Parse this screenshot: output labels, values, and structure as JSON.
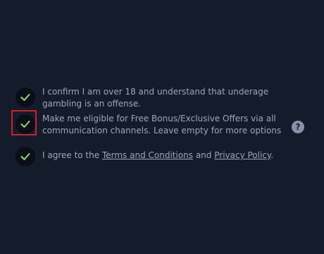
{
  "consents": {
    "age": {
      "text": "I confirm I am over 18 and understand that underage gambling is an offense.",
      "checked": true
    },
    "bonus": {
      "text": "Make me eligible for Free Bonus/Exclusive Offers via all communication channels. Leave empty for more options",
      "checked": true
    },
    "terms": {
      "prefix": "I agree to the ",
      "terms_link": "Terms and Conditions",
      "middle": " and ",
      "privacy_link": "Privacy Policy",
      "suffix": ".",
      "checked": true
    }
  },
  "help_icon": {
    "glyph": "?",
    "icon": "question-circle-icon"
  },
  "colors": {
    "background": "#141c2b",
    "checkbox_bg": "#0a0f17",
    "check": "#8fdc6a",
    "text": "#9aa7b8",
    "highlight": "#d0202a"
  }
}
